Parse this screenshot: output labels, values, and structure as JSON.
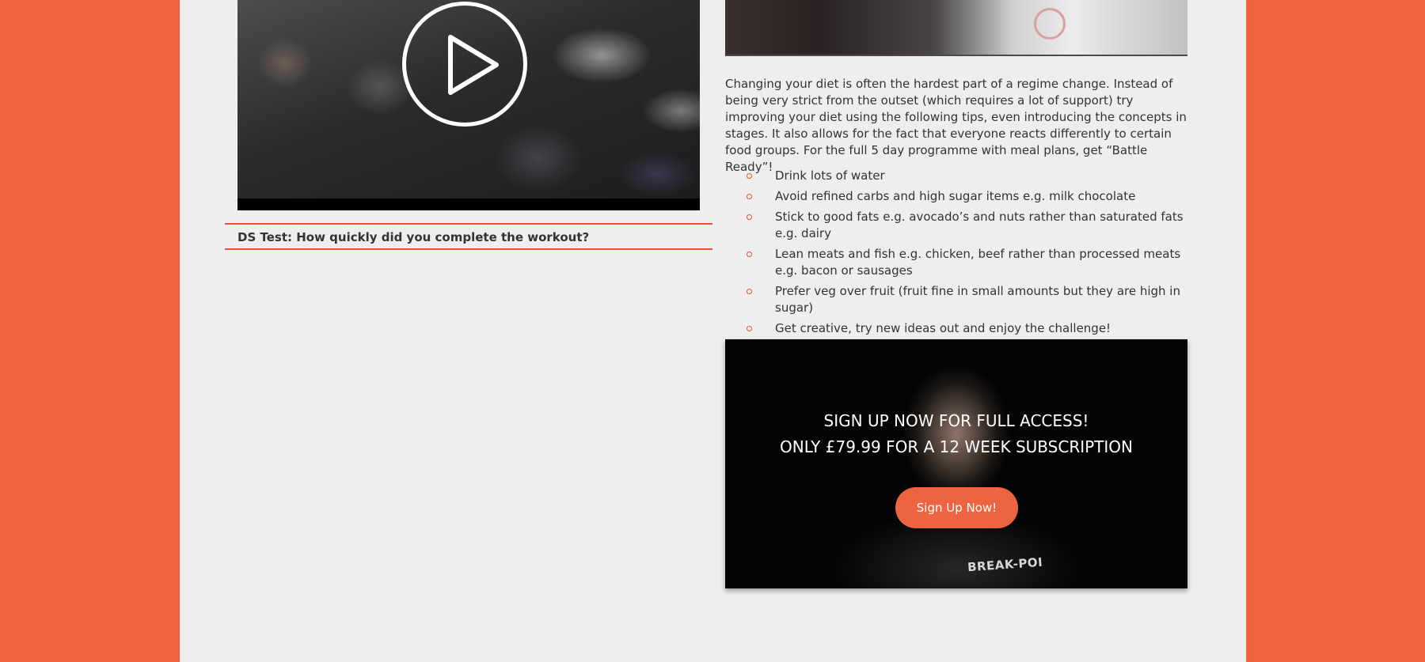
{
  "colors": {
    "page_background": "#f06440",
    "content_background": "#eeeeee",
    "accent": "#e2552f",
    "button": "#ef6440"
  },
  "video": {
    "play_icon": "play-icon"
  },
  "quiz": {
    "title": "DS Test: How quickly did you complete the workout?"
  },
  "article": {
    "intro": "Changing your diet is often the hardest part of a regime change. Instead of being very strict from the outset (which requires a lot of support) try improving your diet using the following tips, even introducing the concepts in stages. It also allows for the fact that everyone reacts differently to certain food groups. For the full 5 day programme with meal plans, get “Battle Ready”!",
    "tips": [
      "Drink lots of water",
      "Avoid refined carbs and high sugar items e.g. milk chocolate",
      "Stick to good fats e.g. avocado’s and nuts rather than saturated fats e.g. dairy",
      "Lean meats and fish e.g. chicken, beef rather than processed meats e.g. bacon or sausages",
      "Prefer veg over fruit (fruit fine in small amounts but they are high in sugar)",
      "Get creative, try new ideas out and enjoy the challenge!"
    ]
  },
  "promo": {
    "line1": "SIGN UP NOW FOR FULL ACCESS!",
    "line2": "ONLY £79.99 FOR A 12 WEEK SUBSCRIPTION",
    "button_label": "Sign Up Now!",
    "logo_text": "BREAK-POI"
  }
}
